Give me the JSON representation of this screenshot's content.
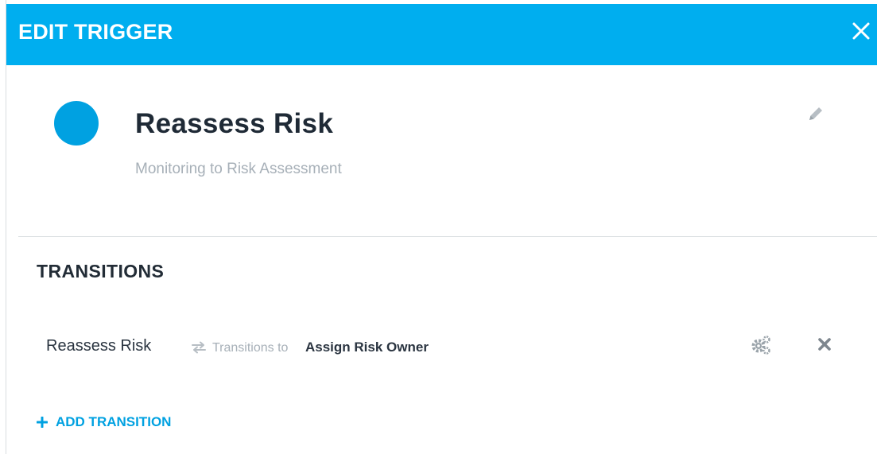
{
  "dialog": {
    "title": "EDIT TRIGGER",
    "accent_color": "#00aeef"
  },
  "trigger": {
    "name": "Reassess Risk",
    "subtitle": "Monitoring to Risk Assessment",
    "status_color": "#00a1e1"
  },
  "transitions": {
    "heading": "TRANSITIONS",
    "items": [
      {
        "name": "Reassess Risk",
        "label": "Transitions to",
        "target": "Assign Risk Owner"
      }
    ],
    "add_label": "ADD TRANSITION"
  },
  "icons": {
    "close": "close-icon",
    "edit": "pencil-icon",
    "arrows": "swap-arrows-icon",
    "settings": "gears-icon",
    "delete": "x-icon",
    "add": "plus-icon"
  }
}
